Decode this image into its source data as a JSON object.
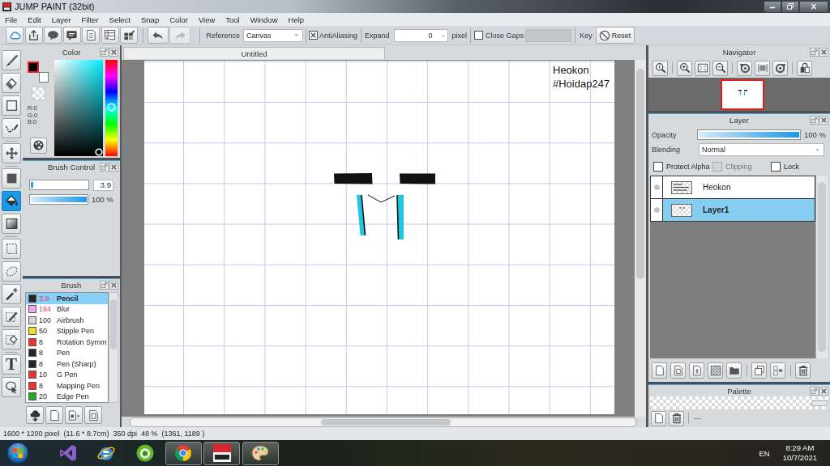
{
  "window": {
    "title": "JUMP PAINT (32bit)"
  },
  "menu": [
    "File",
    "Edit",
    "Layer",
    "Filter",
    "Select",
    "Snap",
    "Color",
    "View",
    "Tool",
    "Window",
    "Help"
  ],
  "toolbar": {
    "undo": {
      "disabled": false
    },
    "redo": {
      "disabled": true
    },
    "reference": {
      "label": "Reference",
      "value": "Canvas"
    },
    "antialiasing": {
      "label": "AntiAliasing",
      "checked": true
    },
    "expand": {
      "label": "Expand",
      "value": "0",
      "unit": "pixel"
    },
    "close_gaps": {
      "label": "Close Gaps",
      "checked": false
    },
    "gap_slider": {
      "disabled": true
    },
    "key": {
      "label": "Key",
      "button": "Reset"
    }
  },
  "tools": [
    {
      "tools": [
        {
          "kind": "brush",
          "selected": false
        },
        {
          "kind": "eraser",
          "selected": false
        },
        {
          "kind": "shape",
          "selected": false
        },
        {
          "kind": "polyline",
          "selected": false
        }
      ]
    },
    {
      "tools": [
        {
          "kind": "move",
          "selected": false
        }
      ]
    },
    {
      "tools": [
        {
          "kind": "fill",
          "selected": false
        },
        {
          "kind": "bucket",
          "selected": true
        },
        {
          "kind": "gradient",
          "selected": false
        }
      ]
    },
    {
      "tools": [
        {
          "kind": "marquee",
          "selected": false
        },
        {
          "kind": "lasso",
          "selected": false
        },
        {
          "kind": "wand",
          "selected": false
        },
        {
          "kind": "maskpen",
          "selected": false
        },
        {
          "kind": "maskeraser",
          "selected": false
        }
      ]
    },
    {
      "tools": [
        {
          "kind": "text",
          "glyph": "T",
          "selected": false
        },
        {
          "kind": "pointer",
          "selected": false
        }
      ]
    }
  ],
  "color_panel": {
    "title": "Color",
    "swatches": [
      {
        "color": "#000000"
      },
      {
        "color": "#ffffff"
      }
    ],
    "rgb": [
      "R:0",
      "G:0",
      "B:0"
    ],
    "hue": {
      "level": 0.49
    }
  },
  "brush_control": {
    "title": "Brush Control",
    "size": {
      "level": 0.04,
      "value": "3.9"
    },
    "opacity": {
      "level": 1,
      "reading": "100 %"
    }
  },
  "brush_panel": {
    "title": "Brush",
    "items": [
      {
        "color": "#262626",
        "size": "3.9",
        "name": "Pencil",
        "size_marked": true,
        "selected": true
      },
      {
        "color": "#f2a6f2",
        "size": "194",
        "name": "Blur",
        "size_marked": true,
        "selected": false
      },
      {
        "color": "#d4d4d4",
        "size": "100",
        "name": "Airbrush",
        "size_marked": false,
        "selected": false
      },
      {
        "color": "#eedd22",
        "size": "50",
        "name": "Stipple Pen",
        "size_marked": false,
        "selected": false
      },
      {
        "color": "#ee3333",
        "size": "8",
        "name": "Rotation Symm",
        "size_marked": false,
        "selected": false
      },
      {
        "color": "#262626",
        "size": "8",
        "name": "Pen",
        "size_marked": false,
        "selected": false
      },
      {
        "color": "#262626",
        "size": "8",
        "name": "Pen (Sharp)",
        "size_marked": false,
        "selected": false
      },
      {
        "color": "#ee3333",
        "size": "10",
        "name": "G Pen",
        "size_marked": false,
        "selected": false
      },
      {
        "color": "#ee3333",
        "size": "8",
        "name": "Mapping Pen",
        "size_marked": false,
        "selected": false
      },
      {
        "color": "#22aa22",
        "size": "20",
        "name": "Edge Pen",
        "size_marked": false,
        "selected": false
      }
    ]
  },
  "document_tabs": [
    {
      "label": "Untitled",
      "selected": true
    }
  ],
  "canvas": {
    "texts": [
      "Heokon",
      "#Hoidap247"
    ]
  },
  "navigator": {
    "title": "Navigator"
  },
  "layer_panel": {
    "title": "Layer",
    "opacity": {
      "label": "Opacity",
      "level": 1,
      "reading": "100 %"
    },
    "blending": {
      "label": "Blending",
      "value": "Normal"
    },
    "options": [
      {
        "label": "Protect Alpha",
        "checked": false,
        "disabled": false
      },
      {
        "label": "Clipping",
        "checked": false,
        "disabled": true
      },
      {
        "label": "Lock",
        "checked": false,
        "disabled": false
      }
    ],
    "layers": [
      {
        "name": "Heokon",
        "kind": "text",
        "selected": false
      },
      {
        "name": "Layer1",
        "kind": "raster",
        "selected": true
      }
    ]
  },
  "palette": {
    "title": "Palette",
    "status": "---"
  },
  "status_bar": [
    "1600 * 1200 pixel",
    "(11.6 * 8.7cm)",
    "350 dpi",
    "48 %",
    "(1361, 1189 )"
  ],
  "taskbar": {
    "apps": [
      {
        "kind": "ribbon",
        "running": false
      },
      {
        "kind": "globe",
        "running": false
      },
      {
        "kind": "ring",
        "running": false
      },
      {
        "kind": "wheel",
        "running": true
      },
      {
        "kind": "logo",
        "running": true
      },
      {
        "kind": "palette",
        "running": true
      }
    ],
    "language": "EN",
    "time": "8:29 AM",
    "date": "10/7/2021"
  }
}
